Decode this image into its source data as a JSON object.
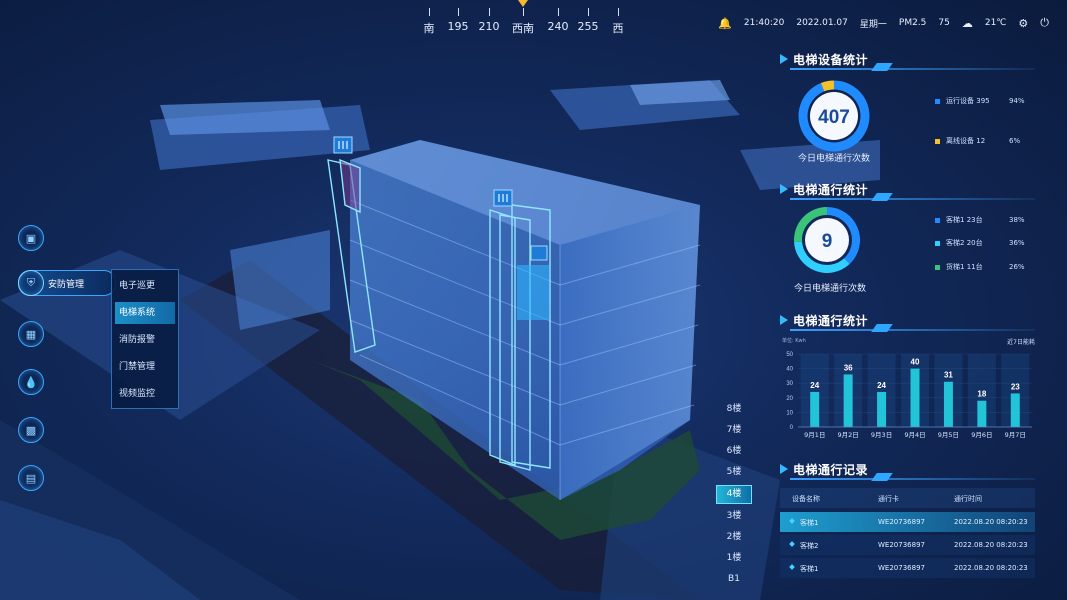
{
  "compass": {
    "labels": [
      "南",
      "195",
      "210",
      "西南",
      "240",
      "255",
      "西"
    ]
  },
  "topbar": {
    "time": "21:40:20",
    "date": "2022.01.07",
    "weekday": "星期一",
    "pm_label": "PM2.5",
    "pm_value": "75",
    "temperature": "21℃"
  },
  "left_nav": {
    "active_label": "安防管理",
    "submenu": [
      "电子巡更",
      "电梯系统",
      "消防报警",
      "门禁管理",
      "视频监控"
    ],
    "submenu_active_index": 1
  },
  "floors": {
    "items": [
      "8楼",
      "7楼",
      "6楼",
      "5楼",
      "4楼",
      "3楼",
      "2楼",
      "1楼",
      "B1"
    ],
    "active": "4楼"
  },
  "panel1": {
    "title": "电梯设备统计",
    "center_value": "407",
    "caption": "今日电梯通行次数",
    "items": [
      {
        "name": "运行设备",
        "count": "395",
        "percent": "94%",
        "color": "#1f8bff"
      },
      {
        "name": "离线设备",
        "count": "12",
        "percent": "6%",
        "color": "#f2c12e"
      }
    ],
    "ratio": 0.94
  },
  "panel2": {
    "title": "电梯通行统计",
    "center_value": "9",
    "caption": "今日电梯通行次数",
    "items": [
      {
        "name": "客梯1",
        "count": "23台",
        "percent": "38%",
        "color": "#1f8bff"
      },
      {
        "name": "客梯2",
        "count": "20台",
        "percent": "36%",
        "color": "#2fd0ff"
      },
      {
        "name": "货梯1",
        "count": "11台",
        "percent": "26%",
        "color": "#3ac47a"
      }
    ],
    "shares": [
      0.38,
      0.36,
      0.26
    ]
  },
  "panel3": {
    "title": "电梯通行统计",
    "unit_label": "单位: Kwh",
    "range_label": "近7日能耗",
    "chart_data": {
      "type": "bar",
      "categories": [
        "9月1日",
        "9月2日",
        "9月3日",
        "9月4日",
        "9月5日",
        "9月6日",
        "9月7日"
      ],
      "values": [
        24,
        36,
        24,
        40,
        31,
        18,
        23
      ],
      "ylim": [
        0,
        50
      ],
      "yticks": [
        "50",
        "40",
        "30",
        "20",
        "10",
        "0"
      ],
      "ylabel": "单位: Kwh"
    }
  },
  "panel4": {
    "title": "电梯通行记录",
    "headers": [
      "设备名称",
      "通行卡",
      "通行时间"
    ],
    "rows": [
      {
        "name": "客梯1",
        "card": "WE20736897",
        "time": "2022.08.20  08:20:23"
      },
      {
        "name": "客梯2",
        "card": "WE20736897",
        "time": "2022.08.20  08:20:23"
      },
      {
        "name": "客梯1",
        "card": "WE20736897",
        "time": "2022.08.20  08:20:23"
      }
    ]
  }
}
